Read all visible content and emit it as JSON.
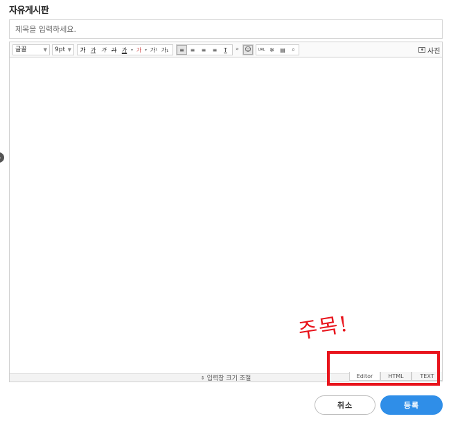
{
  "board": {
    "title": "자유게시판"
  },
  "subject": {
    "placeholder": "제목을 입력하세요.",
    "value": ""
  },
  "toolbar": {
    "font_family": "글꼴",
    "font_size": "9pt",
    "style_buttons": [
      "가",
      "가",
      "가",
      "가",
      "가"
    ],
    "color_glyph": "가",
    "superscript": "가¹",
    "subscript": "가₁",
    "overflow": "»",
    "photo_label": "사진",
    "url_label": "URL"
  },
  "editor": {
    "resize_label": "입력창 크기 조절",
    "modes": [
      "Editor",
      "HTML",
      "TEXT"
    ],
    "active_mode": "Editor"
  },
  "annotation": {
    "text": "주목!",
    "color": "#e8141c"
  },
  "actions": {
    "cancel": "취소",
    "submit": "등록"
  },
  "colors": {
    "accent": "#2f8ee8",
    "border": "#cfcfcf"
  }
}
